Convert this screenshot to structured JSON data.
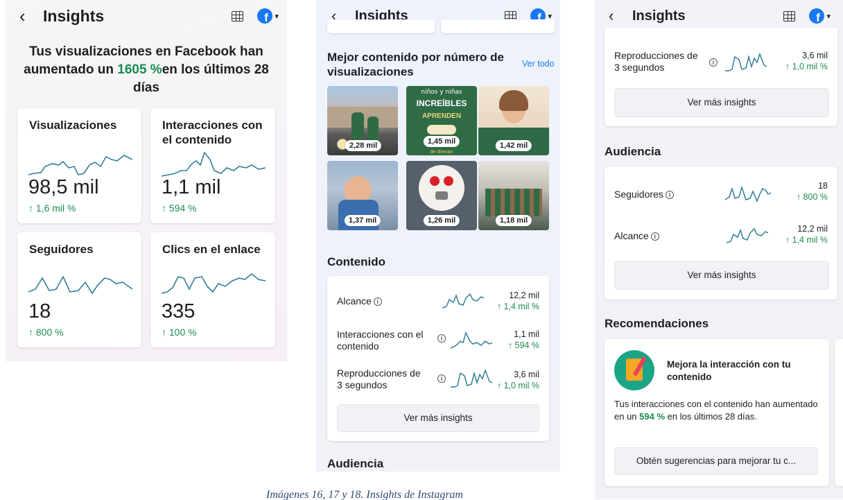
{
  "header": {
    "title": "Insights",
    "back_glyph": "‹",
    "fb_letter": "f",
    "caret": "▾",
    "icons": [
      "back-icon",
      "table-icon",
      "facebook-icon",
      "chevron-down-icon"
    ]
  },
  "accent": {
    "green": "#1a8c4e",
    "blue": "#1877f2"
  },
  "panel1": {
    "headline_pre": "Tus visualizaciones en Facebook han aumentado un ",
    "headline_pct": "1605 %",
    "headline_post": "en los últimos 28 días",
    "metrics": [
      {
        "title": "Visualizaciones",
        "value": "98,5 mil",
        "change": "↑ 1,6 mil %"
      },
      {
        "title": "Interacciones con el contenido",
        "value": "1,1 mil",
        "change": "↑ 594 %"
      },
      {
        "title": "Seguidores",
        "value": "18",
        "change": "↑ 800 %"
      },
      {
        "title": "Clics en el enlace",
        "value": "335",
        "change": "↑ 100 %"
      }
    ]
  },
  "panel2": {
    "best_title": "Mejor contenido por número de visualizaciones",
    "see_all": "Ver todo",
    "thumbs": [
      {
        "label": "2,28 mil"
      },
      {
        "label": "1,45 mil",
        "poster_lines": [
          "niños y niñas",
          "INCREÍBLES",
          "APRENDEN",
          "de director"
        ]
      },
      {
        "label": "1,42 mil"
      },
      {
        "label": "1,37 mil"
      },
      {
        "label": "1,26 mil"
      },
      {
        "label": "1,18 mil"
      }
    ],
    "content_title": "Contenido",
    "rows": [
      {
        "label": "Alcance",
        "value": "12,2 mil",
        "change": "↑ 1,4 mil %"
      },
      {
        "label": "Interacciones con el contenido",
        "value": "1,1 mil",
        "change": "↑ 594 %"
      },
      {
        "label": "Reproducciones de 3 segundos",
        "value": "3,6 mil",
        "change": "↑ 1,0 mil %"
      }
    ],
    "more_button": "Ver más insights",
    "audience_title": "Audiencia"
  },
  "panel3": {
    "top_row": {
      "label": "Reproducciones de 3 segundos",
      "value": "3,6 mil",
      "change": "↑ 1,0 mil %"
    },
    "more_button": "Ver más insights",
    "audience_title": "Audiencia",
    "audience_rows": [
      {
        "label": "Seguidores",
        "value": "18",
        "change": "↑ 800 %"
      },
      {
        "label": "Alcance",
        "value": "12,2 mil",
        "change": "↑ 1,4 mil %"
      }
    ],
    "audience_button": "Ver más insights",
    "reco_title": "Recomendaciones",
    "reco_card": {
      "heading": "Mejora la interacción con tu contenido",
      "body_pre": "Tus interacciones con el contenido han aumentado en un ",
      "body_pct": "594 %",
      "body_post": " en los últimos 28 días.",
      "button": "Obtén sugerencias para mejorar tu c..."
    }
  },
  "caption": "Imágenes 16, 17 y 18. Insights de Instagram"
}
